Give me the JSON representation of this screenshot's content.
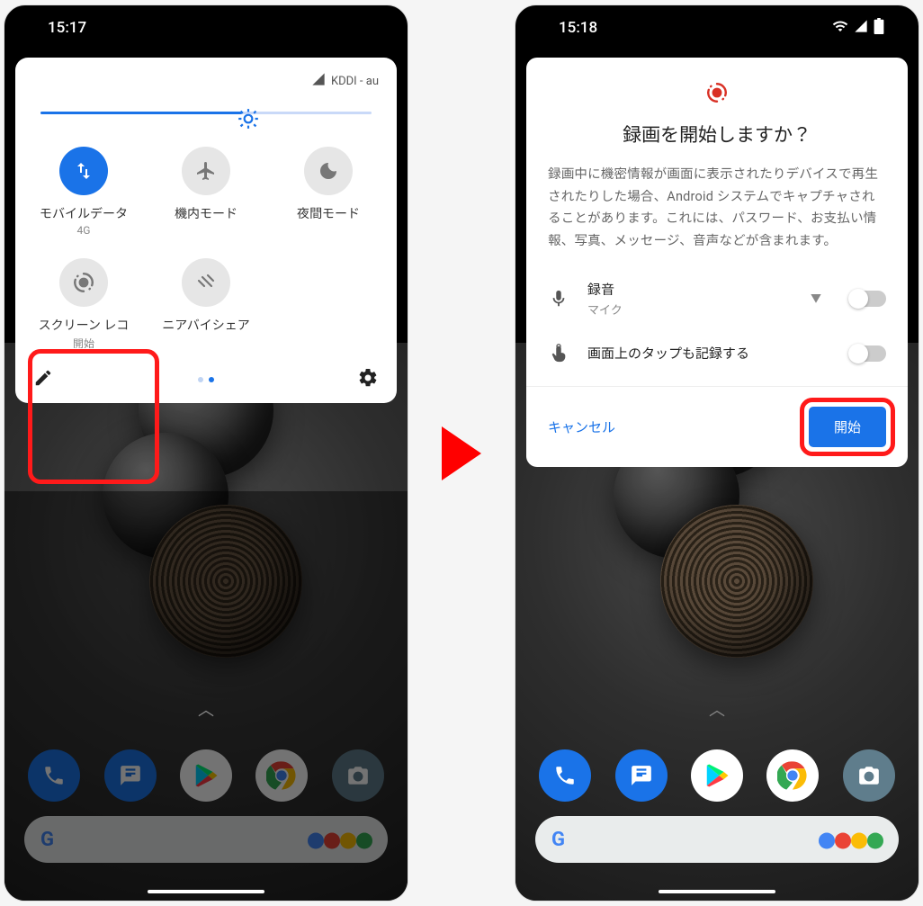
{
  "left": {
    "time": "15:17",
    "carrier": "KDDI - au",
    "tiles": [
      {
        "label": "モバイルデータ",
        "sub": "4G",
        "icon": "swap-vert-icon",
        "active": true
      },
      {
        "label": "機内モード",
        "sub": "",
        "icon": "airplane-icon",
        "active": false
      },
      {
        "label": "夜間モード",
        "sub": "",
        "icon": "moon-icon",
        "active": false
      },
      {
        "label": "スクリーン レコ",
        "sub": "開始",
        "icon": "record-icon",
        "active": false
      },
      {
        "label": "ニアバイシェア",
        "sub": "",
        "icon": "nearby-icon",
        "active": false
      }
    ],
    "brightness_percent": 61
  },
  "right": {
    "time": "15:18",
    "dialog": {
      "title": "録画を開始しますか？",
      "body": "録画中に機密情報が画面に表示されたりデバイスで再生されたりした場合、Android システムでキャプチャされることがあります。これには、パスワード、お支払い情報、写真、メッセージ、音声などが含まれます。",
      "audio_label": "録音",
      "audio_sub": "マイク",
      "taps_label": "画面上のタップも記録する",
      "cancel": "キャンセル",
      "start": "開始"
    }
  },
  "colors": {
    "accent": "#1a73e8",
    "highlight": "#ff1a1a"
  }
}
